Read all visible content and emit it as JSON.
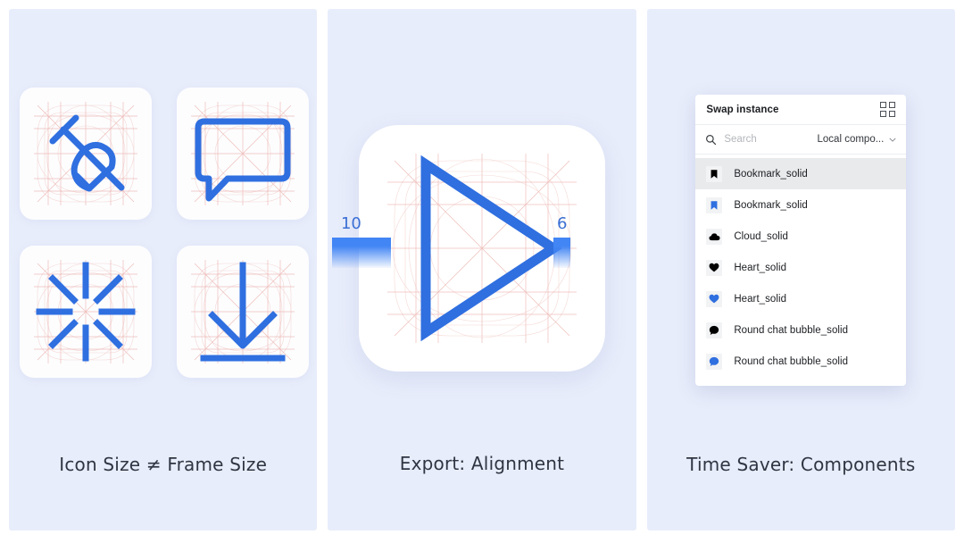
{
  "panels": [
    {
      "caption": "Icon Size  ≠  Frame Size",
      "tiles": [
        {
          "icon_name": "pin-icon"
        },
        {
          "icon_name": "chat-bubble-icon"
        },
        {
          "icon_name": "spinner-icon"
        },
        {
          "icon_name": "download-arrow-icon"
        }
      ]
    },
    {
      "caption": "Export: Alignment",
      "icon_name": "play-triangle-icon",
      "measurements": [
        {
          "label": "10",
          "side": "left"
        },
        {
          "label": "6",
          "side": "right"
        }
      ]
    },
    {
      "caption": "Time Saver: Components",
      "swap_panel": {
        "title": "Swap instance",
        "grid_view_icon": "grid-view-icon",
        "search": {
          "icon": "search-icon",
          "placeholder": "Search",
          "value": ""
        },
        "filter": {
          "label": "Local compo...",
          "chevron_icon": "chevron-down-icon"
        },
        "items": [
          {
            "label": "Bookmark_solid",
            "icon": "bookmark-icon",
            "color": "#000000",
            "selected": true
          },
          {
            "label": "Bookmark_solid",
            "icon": "bookmark-icon",
            "color": "#2f6fe0",
            "selected": false
          },
          {
            "label": "Cloud_solid",
            "icon": "cloud-icon",
            "color": "#000000",
            "selected": false
          },
          {
            "label": "Heart_solid",
            "icon": "heart-icon",
            "color": "#000000",
            "selected": false
          },
          {
            "label": "Heart_solid",
            "icon": "heart-icon",
            "color": "#2f6fe0",
            "selected": false
          },
          {
            "label": "Round chat bubble_solid",
            "icon": "round-chat-bubble-icon",
            "color": "#000000",
            "selected": false
          },
          {
            "label": "Round chat bubble_solid",
            "icon": "round-chat-bubble-icon",
            "color": "#2f6fe0",
            "selected": false
          }
        ]
      }
    }
  ],
  "colors": {
    "panel_bg": "#e8edfb",
    "accent_blue": "#2f6fe0",
    "measure_blue": "#4285f4",
    "keyline_red": "#e8a9a4",
    "caption_text": "#2f3542"
  }
}
